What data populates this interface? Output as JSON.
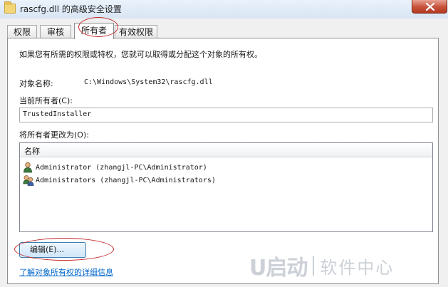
{
  "window": {
    "title": "rascfg.dll 的高级安全设置"
  },
  "tabs": [
    {
      "label": "权限",
      "active": false
    },
    {
      "label": "审核",
      "active": false
    },
    {
      "label": "所有者",
      "active": true
    },
    {
      "label": "有效权限",
      "active": false
    }
  ],
  "owner_panel": {
    "description": "如果您有所需的权限或特权，您就可以取得或分配这个对象的所有权。",
    "object_name_label": "对象名称:",
    "object_name_value": "C:\\Windows\\System32\\rascfg.dll",
    "current_owner_label": "当前所有者(C):",
    "current_owner_value": "TrustedInstaller",
    "change_owner_label": "将所有者更改为(O):",
    "list_header": "名称",
    "owners": [
      {
        "name": "Administrator (zhangjl-PC\\Administrator)",
        "icon": "user-icon"
      },
      {
        "name": "Administrators (zhangjl-PC\\Administrators)",
        "icon": "users-group-icon"
      }
    ],
    "edit_button": "编辑(E)...",
    "learn_more_link": "了解对象所有权的详细信息"
  },
  "watermark": {
    "logo": "U启动",
    "text": "软件中心"
  },
  "colors": {
    "annotation": "#c42a2a",
    "link": "#0066cc",
    "button_border": "#3c7fb1"
  }
}
